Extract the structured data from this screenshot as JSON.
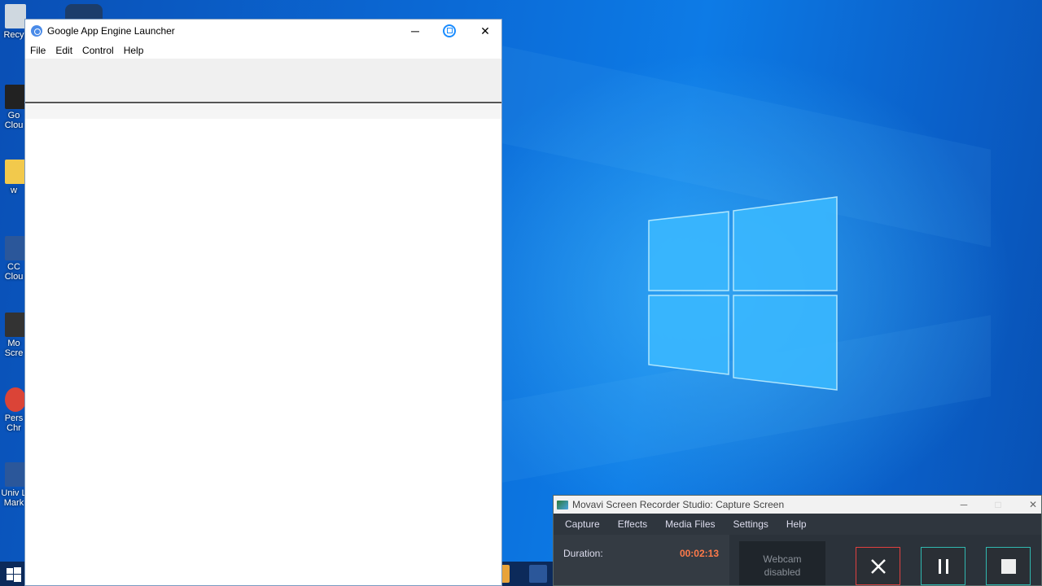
{
  "desktop": {
    "icons": [
      {
        "label": "Recy"
      },
      {
        "label": "Go Clou"
      },
      {
        "label": "w"
      },
      {
        "label": "CC Clou"
      },
      {
        "label": "Mo Scre"
      },
      {
        "label": "Pers Chr"
      },
      {
        "label": "Univ L Mark"
      }
    ]
  },
  "gae_window": {
    "title": "Google App Engine Launcher",
    "controls": {
      "minimize": "─",
      "maximize": "□",
      "close": "✕"
    },
    "menu": [
      "File",
      "Edit",
      "Control",
      "Help"
    ]
  },
  "movavi": {
    "title": "Movavi Screen Recorder Studio: Capture Screen",
    "controls": {
      "minimize": "─",
      "maximize": "□",
      "close": "✕"
    },
    "menu": [
      "Capture",
      "Effects",
      "Media Files",
      "Settings",
      "Help"
    ],
    "duration_label": "Duration:",
    "duration_value": "00:02:13",
    "webcam_line1": "Webcam",
    "webcam_line2": "disabled",
    "colors": {
      "cancel": "#e04040",
      "accent": "#30b8b0",
      "duration": "#ff7a4a"
    }
  }
}
